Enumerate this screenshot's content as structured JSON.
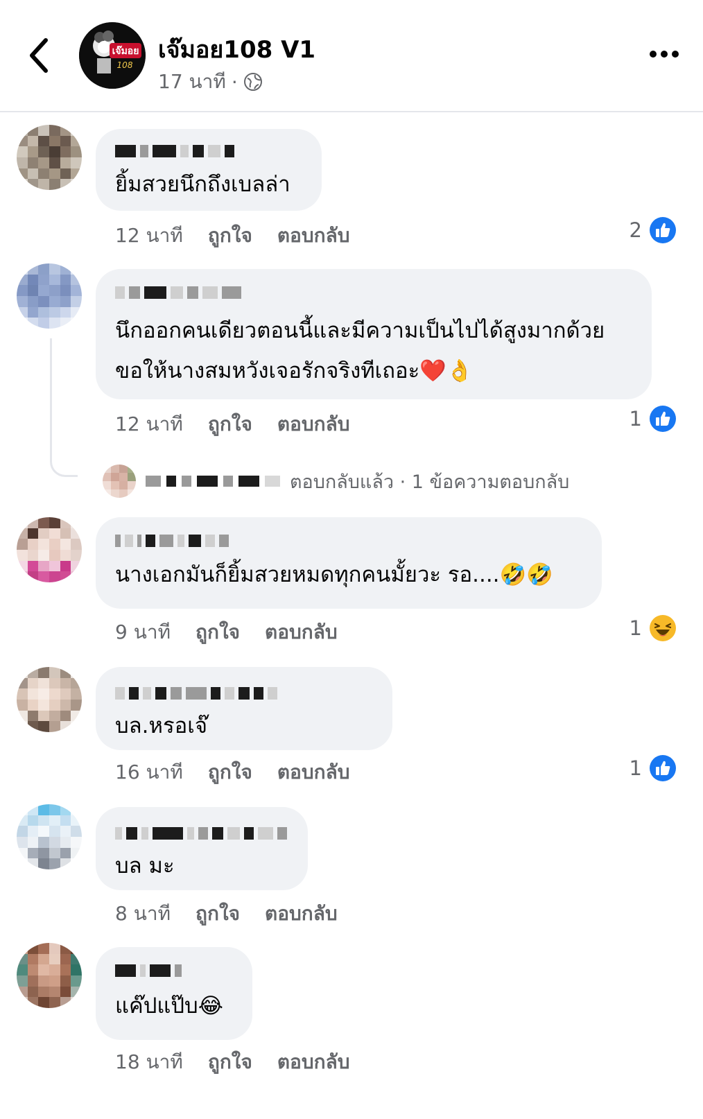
{
  "header": {
    "page_name": "เจ๊มอย108 V1",
    "post_time": "17 นาที",
    "meta_separator": "·",
    "avatar_logo_text": "เจ๊มอย 108"
  },
  "comments": [
    {
      "text": "ยิ้มสวยนึกถึงเบลล่า",
      "time": "12 นาที",
      "like_label": "ถูกใจ",
      "reply_label": "ตอบกลับ",
      "reaction_count": "2",
      "reaction_icon": "like-icon"
    },
    {
      "text_line1": "นึกออกคนเดียวตอนนี้และมีความเป็นไปได้สูงมากด้วย",
      "text_line2": "ขอให้นางสมหวังเจอรักจริงทีเถอะ❤️👌",
      "time": "12 นาที",
      "like_label": "ถูกใจ",
      "reply_label": "ตอบกลับ",
      "reaction_count": "1",
      "reaction_icon": "like-icon",
      "reply_summary": "ตอบกลับแล้ว · 1 ข้อความตอบกลับ"
    },
    {
      "text": "นางเอกมันก็ยิ้มสวยหมดทุกคนมั้ยวะ รอ....🤣🤣",
      "time": "9 นาที",
      "like_label": "ถูกใจ",
      "reply_label": "ตอบกลับ",
      "reaction_count": "1",
      "reaction_icon": "haha-icon"
    },
    {
      "text": "บล.หรอเจ๊",
      "time": "16 นาที",
      "like_label": "ถูกใจ",
      "reply_label": "ตอบกลับ",
      "reaction_count": "1",
      "reaction_icon": "like-icon"
    },
    {
      "text": "บล มะ",
      "time": "8 นาที",
      "like_label": "ถูกใจ",
      "reply_label": "ตอบกลับ"
    },
    {
      "text": "แค๊ปแป๊บ😂",
      "time": "18 นาที",
      "like_label": "ถูกใจ",
      "reply_label": "ตอบกลับ"
    }
  ],
  "colors": {
    "bubble": "#f0f2f5",
    "secondary_text": "#65676b",
    "like_blue": "#1877f2",
    "haha_yellow": "#f7b928"
  }
}
